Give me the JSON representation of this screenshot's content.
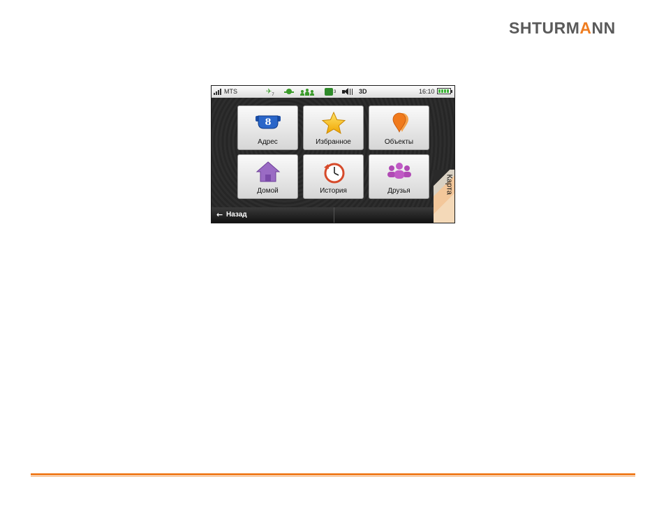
{
  "brand": {
    "name_part1": "SHTURM",
    "name_accent": "A",
    "name_part2": "NN"
  },
  "statusbar": {
    "carrier": "MTS",
    "satellites": "7",
    "traffic_count": "3",
    "mode": "3D",
    "time": "16:10",
    "battery_level": 1.0
  },
  "menu": {
    "items": [
      {
        "label": "Адрес",
        "icon": "address-sign-icon"
      },
      {
        "label": "Избранное",
        "icon": "star-icon"
      },
      {
        "label": "Объекты",
        "icon": "poi-pins-icon"
      },
      {
        "label": "Домой",
        "icon": "home-icon"
      },
      {
        "label": "История",
        "icon": "history-clock-icon"
      },
      {
        "label": "Друзья",
        "icon": "friends-icon"
      }
    ]
  },
  "address_icon_number": "8",
  "bottombar": {
    "back_label": "Назад",
    "map_label": "Карта"
  },
  "colors": {
    "accent": "#ef7d21",
    "brand_gray": "#5a5a5a",
    "status_green": "#3a9a2a"
  }
}
